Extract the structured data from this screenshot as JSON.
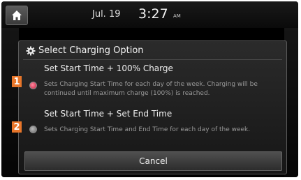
{
  "status_bar": {
    "date": "Jul. 19",
    "time": "3:27",
    "ampm": "AM"
  },
  "dialog": {
    "title": "Select Charging Option",
    "options": [
      {
        "badge": "1",
        "title": "Set Start Time + 100% Charge",
        "description": "Sets Charging Start Time for each day of the week. Charging will be continued until maximum charge (100%) is reached.",
        "selected": true
      },
      {
        "badge": "2",
        "title": "Set Start Time + Set End Time",
        "description": "Sets Charging Start Time and End Time for each day of the week.",
        "selected": false
      }
    ],
    "cancel_label": "Cancel"
  },
  "colors": {
    "badge": "#e8762a",
    "radio_selected": "#c41c3c"
  },
  "icons": [
    "home-icon",
    "gear-icon"
  ]
}
